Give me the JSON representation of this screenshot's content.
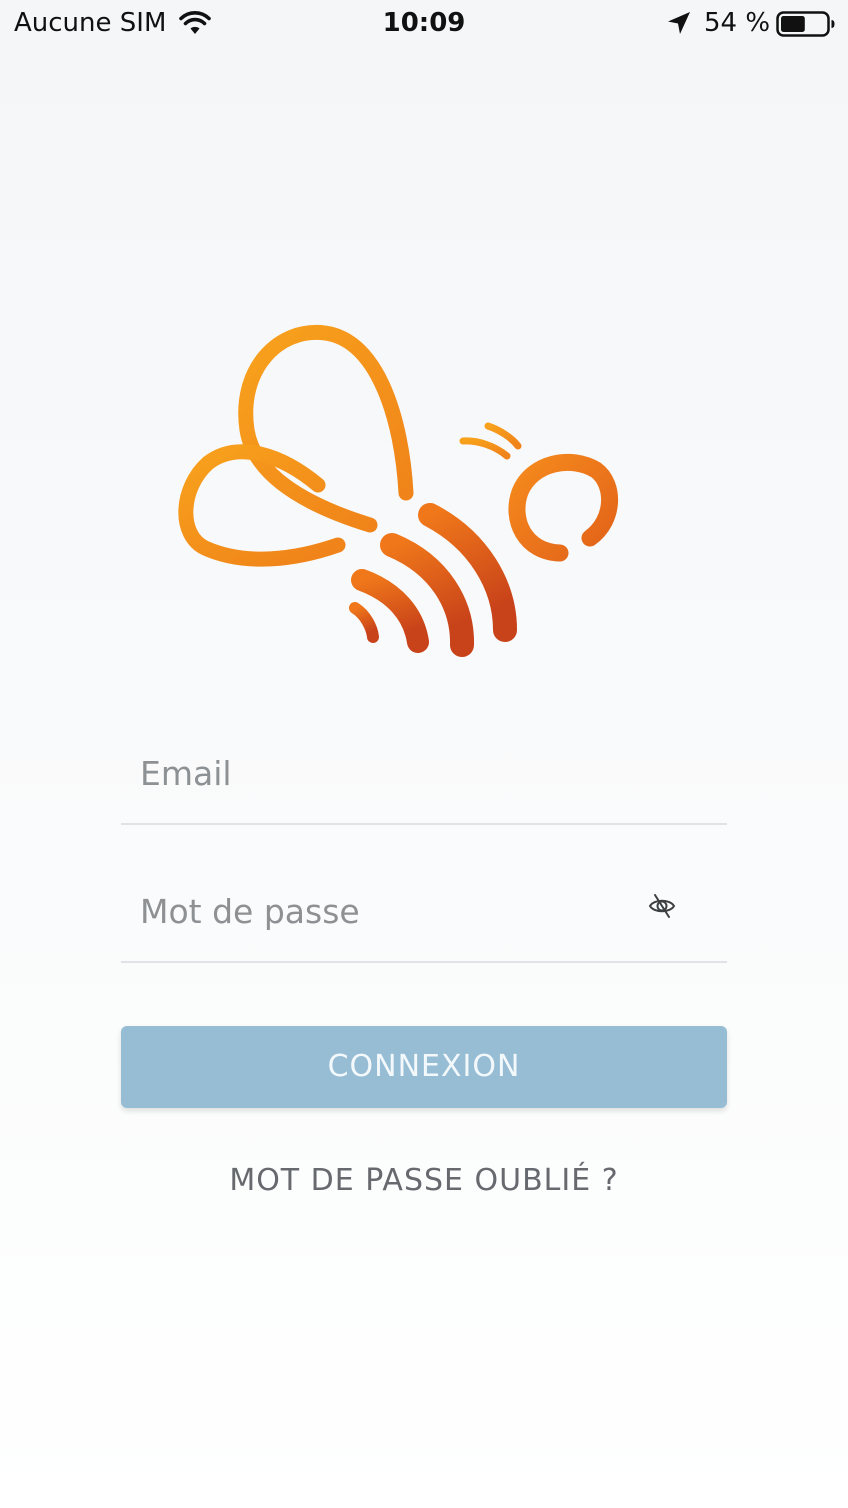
{
  "status_bar": {
    "carrier": "Aucune SIM",
    "time": "10:09",
    "battery": "54 %",
    "battery_level": 0.54,
    "icons": [
      "wifi-icon",
      "location-arrow-icon",
      "battery-icon"
    ]
  },
  "logo": {
    "icon": "bee-logo",
    "colors": [
      "#f7a21b",
      "#e8661a",
      "#c9451a"
    ]
  },
  "form": {
    "email_placeholder": "Email",
    "email_value": "",
    "password_placeholder": "Mot de passe",
    "password_value": "",
    "password_toggle_icon": "eye-slash-icon",
    "submit_label": "CONNEXION",
    "forgot_label": "MOT DE PASSE OUBLIÉ ?"
  },
  "colors": {
    "button": "#97bdd5",
    "button_text": "#f3f8fb",
    "text_muted": "#8d9194",
    "link": "#666a6e"
  }
}
